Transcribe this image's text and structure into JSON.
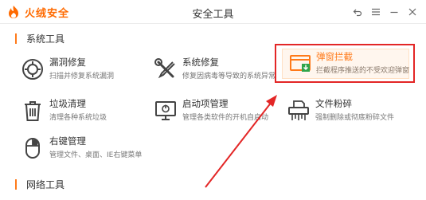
{
  "titlebar": {
    "brand": "火绒安全",
    "title": "安全工具",
    "controls": {
      "back": "back-icon",
      "menu": "menu-icon",
      "minimize": "minimize-icon",
      "close": "close-icon"
    }
  },
  "sections": {
    "system": "系统工具",
    "network": "网络工具"
  },
  "tools": {
    "vuln_repair": {
      "name": "漏洞修复",
      "desc": "扫描并修复系统漏洞",
      "icon": "shield-repair-icon"
    },
    "sys_repair": {
      "name": "系统修复",
      "desc": "修复因病毒等导致的系统异常",
      "icon": "wrench-screwdriver-icon"
    },
    "popup_block": {
      "name": "弹窗拦截",
      "desc": "拦截程序推送的不受欢迎弹窗",
      "icon": "popup-window-icon"
    },
    "junk_clean": {
      "name": "垃圾清理",
      "desc": "清理各种系统垃圾",
      "icon": "trash-icon"
    },
    "startup_mgr": {
      "name": "启动项管理",
      "desc": "管理各类软件的开机自启动",
      "icon": "monitor-power-icon"
    },
    "file_shred": {
      "name": "文件粉碎",
      "desc": "强制删除或彻底粉碎文件",
      "icon": "shredder-icon"
    },
    "context_menu": {
      "name": "右键管理",
      "desc": "管理文件、桌面、IE右键菜单",
      "icon": "mouse-icon"
    }
  },
  "colors": {
    "accent": "#ff7a1a",
    "annotation": "#e32626",
    "icon_gray": "#444444"
  }
}
